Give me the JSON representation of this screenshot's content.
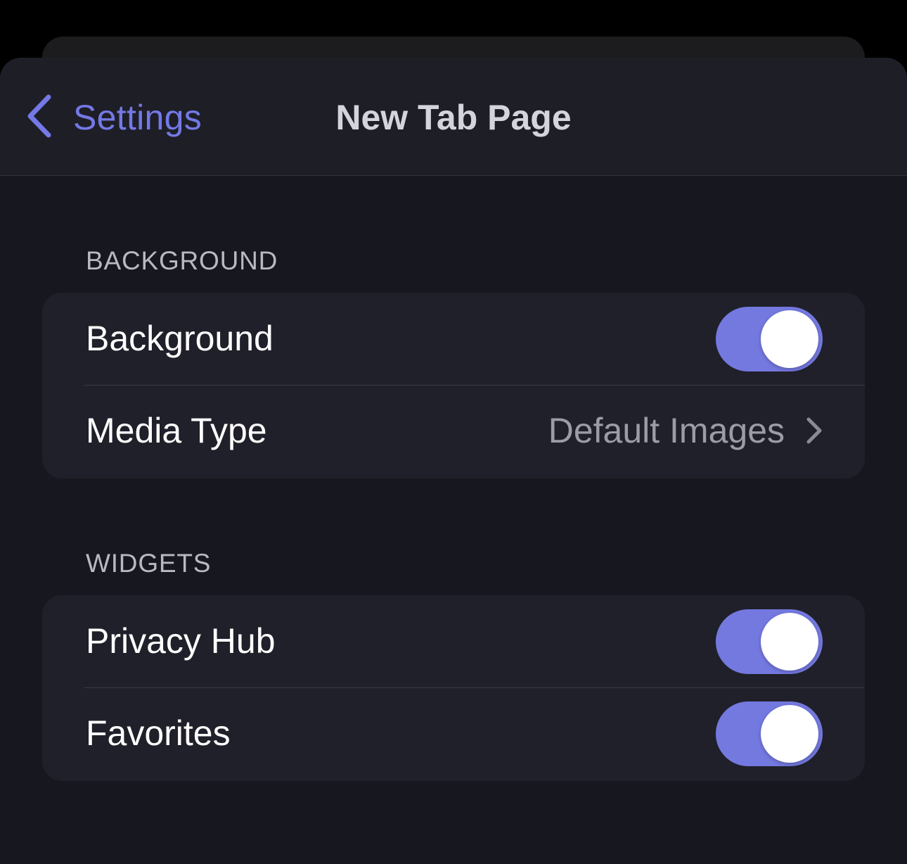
{
  "nav": {
    "back_label": "Settings",
    "title": "New Tab Page",
    "back_icon": "chevron-left-icon"
  },
  "sections": [
    {
      "header": "BACKGROUND",
      "rows": [
        {
          "label": "Background",
          "type": "toggle",
          "on": true
        },
        {
          "label": "Media Type",
          "type": "disclosure",
          "value": "Default Images",
          "icon": "chevron-right-icon"
        }
      ]
    },
    {
      "header": "WIDGETS",
      "rows": [
        {
          "label": "Privacy Hub",
          "type": "toggle",
          "on": true
        },
        {
          "label": "Favorites",
          "type": "toggle",
          "on": true
        }
      ]
    }
  ],
  "colors": {
    "accent": "#7479e6",
    "toggle_on": "#7479e0",
    "background": "#17171f",
    "group_background": "#20202a",
    "nav_background": "#1e1e27"
  }
}
